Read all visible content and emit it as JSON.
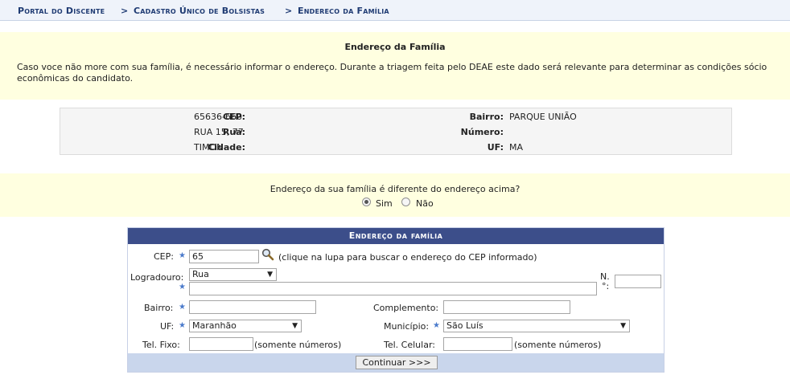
{
  "breadcrumb": {
    "part1": "Portal do Discente",
    "sep1": ">",
    "part2": "Cadastro Único de Bolsistas",
    "sep2": ">",
    "part3": "Endereco da Família"
  },
  "info": {
    "title": "Endereço da Família",
    "text": "Caso voce não more com sua família, é necessário informar o endereço. Durante a triagem feita pelo DEAE este dado será relevante para determinar as condições sócio econômicas do candidato."
  },
  "address": {
    "cep_label": "CEP:",
    "cep": "65636-660",
    "rua_label": "Rua:",
    "rua": "RUA 15, 77",
    "cidade_label": "Cidade:",
    "cidade": "TIMON",
    "bairro_label": "Bairro:",
    "bairro": "PARQUE UNIÃO",
    "numero_label": "Número:",
    "numero": "",
    "uf_label": "UF:",
    "uf": "MA"
  },
  "question": {
    "text": "Endereço da sua família é diferente do endereço acima?",
    "yes": "Sim",
    "no": "Não",
    "selected": "Sim"
  },
  "form": {
    "title": "Endereço da família",
    "cep_label": "CEP:",
    "cep_value": "65",
    "cep_hint": "(clique na lupa para buscar o endereço do CEP informado)",
    "logradouro_label": "Logradouro:",
    "logradouro_type": "Rua",
    "logradouro_value": "",
    "numero_label_1": "N.",
    "numero_label_2": "°:",
    "numero_value": "",
    "bairro_label": "Bairro:",
    "bairro_value": "",
    "complemento_label": "Complemento:",
    "complemento_value": "",
    "uf_label": "UF:",
    "uf_value": "Maranhão",
    "municipio_label": "Município:",
    "municipio_value": "São Luís",
    "tel_fixo_label": "Tel. Fixo:",
    "tel_fixo_value": "",
    "tel_fixo_hint": "(somente números)",
    "tel_cel_label": "Tel. Celular:",
    "tel_cel_value": "",
    "tel_cel_hint": "(somente números)",
    "required_mark": "★",
    "submit_label": "Continuar >>>"
  },
  "colors": {
    "info_background": "#ffffe0",
    "header_background": "#3c4e8a",
    "footer_background": "#c9d6ec",
    "breadcrumb_text": "#1f3b73",
    "required_star": "#4a7acb"
  }
}
